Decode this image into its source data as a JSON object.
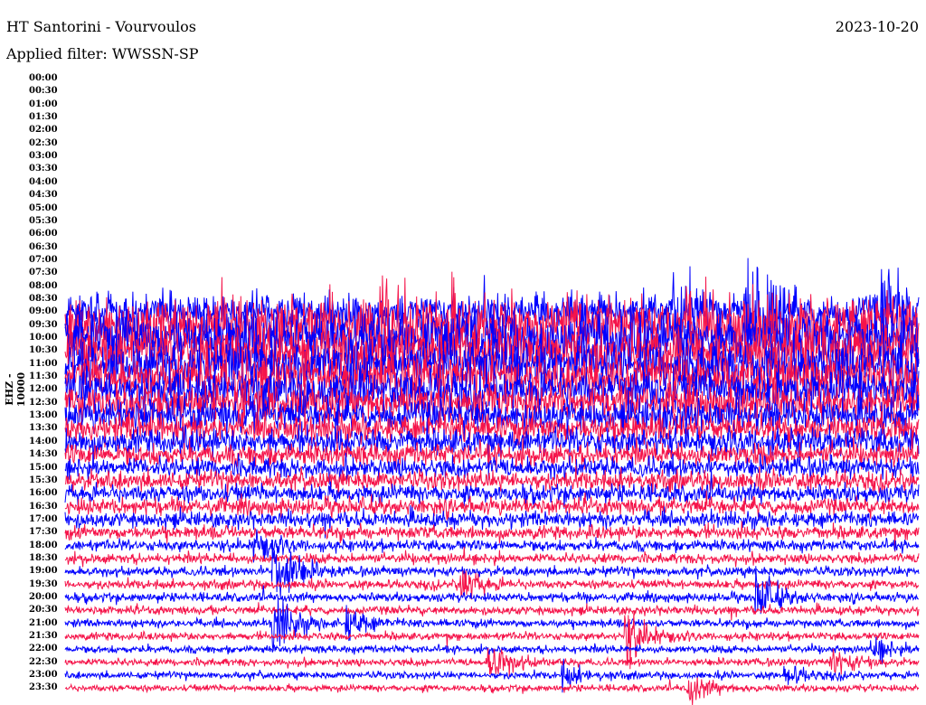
{
  "header": {
    "station": "HT Santorini - Vourvoulos",
    "date": "2023-10-20",
    "filter": "Applied filter: WWSSN-SP"
  },
  "chart_data": {
    "type": "line",
    "title": "HT Santorini - Vourvoulos",
    "ylabel": "EHZ - 10000",
    "row_minutes": 30,
    "tick_labels": [
      "00:00",
      "00:30",
      "01:00",
      "01:30",
      "02:00",
      "02:30",
      "03:00",
      "03:30",
      "04:00",
      "04:30",
      "05:00",
      "05:30",
      "06:00",
      "06:30",
      "07:00",
      "07:30",
      "08:00",
      "08:30",
      "09:00",
      "09:30",
      "10:00",
      "10:30",
      "11:00",
      "11:30",
      "12:00",
      "12:30",
      "13:00",
      "13:30",
      "14:00",
      "14:30",
      "15:00",
      "15:30",
      "16:00",
      "16:30",
      "17:00",
      "17:30",
      "18:00",
      "18:30",
      "19:00",
      "19:30",
      "20:00",
      "20:30",
      "21:00",
      "21:30",
      "22:00",
      "22:30",
      "23:00",
      "23:30"
    ],
    "colors": {
      "even_rows": "#0000ff",
      "odd_rows": "#f5144a"
    },
    "row_noise_amplitude": [
      null,
      null,
      null,
      null,
      null,
      null,
      null,
      null,
      null,
      null,
      null,
      null,
      null,
      null,
      null,
      null,
      null,
      null,
      1.6,
      2.6,
      2.6,
      2.4,
      2.2,
      2.0,
      1.9,
      1.7,
      1.5,
      1.3,
      1.2,
      1.0,
      0.9,
      0.85,
      0.8,
      0.75,
      0.7,
      0.6,
      0.5,
      0.45,
      0.42,
      0.4,
      0.4,
      0.38,
      0.36,
      0.35,
      0.34,
      0.33,
      0.32,
      0.3
    ],
    "events": [
      {
        "row": 18,
        "minute": 24.0,
        "amplitude": 6.0
      },
      {
        "row": 18,
        "minute": 21.5,
        "amplitude": 4.0
      },
      {
        "row": 18,
        "minute": 28.8,
        "amplitude": 3.5
      },
      {
        "row": 19,
        "minute": 11.0,
        "amplitude": 3.0
      },
      {
        "row": 36,
        "minute": 6.7,
        "amplitude": 1.3
      },
      {
        "row": 38,
        "minute": 7.4,
        "amplitude": 4.0
      },
      {
        "row": 39,
        "minute": 14.0,
        "amplitude": 1.6
      },
      {
        "row": 40,
        "minute": 24.4,
        "amplitude": 2.2
      },
      {
        "row": 42,
        "minute": 7.4,
        "amplitude": 3.0
      },
      {
        "row": 42,
        "minute": 10.0,
        "amplitude": 1.5
      },
      {
        "row": 43,
        "minute": 19.8,
        "amplitude": 2.6
      },
      {
        "row": 44,
        "minute": 28.5,
        "amplitude": 1.1
      },
      {
        "row": 45,
        "minute": 15.0,
        "amplitude": 2.0
      },
      {
        "row": 45,
        "minute": 27.0,
        "amplitude": 1.3
      },
      {
        "row": 46,
        "minute": 17.6,
        "amplitude": 1.0
      },
      {
        "row": 46,
        "minute": 25.4,
        "amplitude": 0.9
      },
      {
        "row": 47,
        "minute": 22.0,
        "amplitude": 1.4
      }
    ]
  }
}
